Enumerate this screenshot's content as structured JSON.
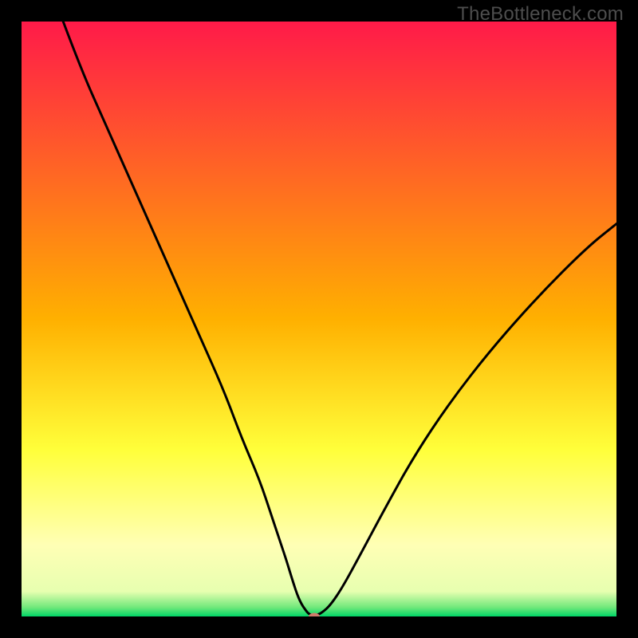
{
  "watermark": {
    "text": "TheBottleneck.com"
  },
  "chart_data": {
    "type": "line",
    "title": "",
    "xlabel": "",
    "ylabel": "",
    "xlim": [
      0,
      100
    ],
    "ylim": [
      0,
      100
    ],
    "grid": false,
    "legend": false,
    "background_gradient": {
      "stops": [
        {
          "offset": 0.0,
          "color": "#ff1a49"
        },
        {
          "offset": 0.5,
          "color": "#ffb000"
        },
        {
          "offset": 0.72,
          "color": "#ffff3a"
        },
        {
          "offset": 0.88,
          "color": "#ffffb5"
        },
        {
          "offset": 0.958,
          "color": "#e7ffb0"
        },
        {
          "offset": 0.985,
          "color": "#6fe87a"
        },
        {
          "offset": 1.0,
          "color": "#00d667"
        }
      ]
    },
    "series": [
      {
        "name": "bottleneck-curve",
        "type": "line",
        "x": [
          7,
          10,
          14,
          18,
          22,
          26,
          30,
          34,
          37,
          40,
          42,
          43.5,
          44.5,
          45.2,
          45.8,
          46.3,
          46.8,
          47.3,
          47.8,
          48.2,
          48.8,
          49.6,
          50.6,
          52,
          54,
          57,
          61,
          66,
          72,
          79,
          87,
          95,
          100
        ],
        "y": [
          100,
          92,
          83,
          74,
          65,
          56,
          47,
          38,
          30,
          23,
          17,
          12.5,
          9.5,
          7.2,
          5.3,
          3.8,
          2.6,
          1.7,
          1.0,
          0.5,
          0.2,
          0.2,
          0.7,
          2.0,
          5.0,
          10.5,
          18,
          27,
          36,
          45,
          54,
          62,
          66
        ]
      }
    ],
    "marker": {
      "x": 49.2,
      "y": 0,
      "color": "#cf7a6b",
      "rx": 7,
      "ry": 4.5
    }
  }
}
